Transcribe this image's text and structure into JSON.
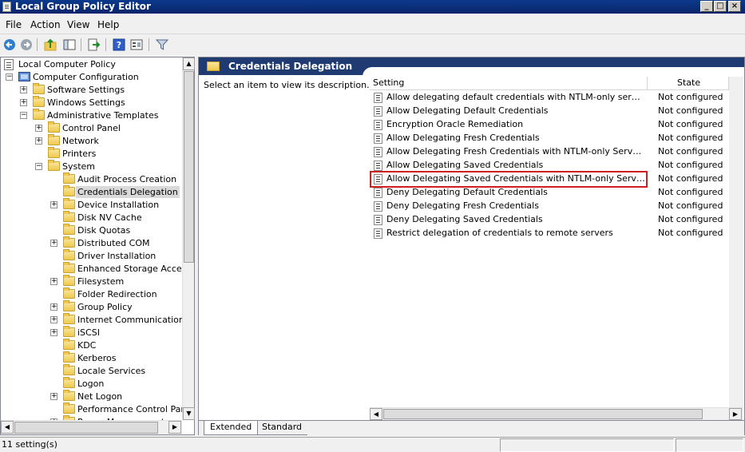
{
  "window": {
    "title": "Local Group Policy Editor"
  },
  "menu": [
    "File",
    "Action",
    "View",
    "Help"
  ],
  "toolbar": {
    "buttons": [
      "back-icon",
      "forward-icon",
      "up-folder-icon",
      "show-hide-tree-icon",
      "export-list-icon",
      "help-icon",
      "properties-icon",
      "filter-icon"
    ]
  },
  "tree": {
    "nodes": [
      {
        "label": "Local Computer Policy",
        "level": 0,
        "expander": "",
        "icon": "policy"
      },
      {
        "label": "Computer Configuration",
        "level": 1,
        "expander": "−",
        "icon": "computer"
      },
      {
        "label": "Software Settings",
        "level": 2,
        "expander": "+",
        "icon": "folder"
      },
      {
        "label": "Windows Settings",
        "level": 2,
        "expander": "+",
        "icon": "folder"
      },
      {
        "label": "Administrative Templates",
        "level": 2,
        "expander": "−",
        "icon": "folder"
      },
      {
        "label": "Control Panel",
        "level": 3,
        "expander": "+",
        "icon": "folder"
      },
      {
        "label": "Network",
        "level": 3,
        "expander": "+",
        "icon": "folder"
      },
      {
        "label": "Printers",
        "level": 3,
        "expander": "",
        "icon": "folder"
      },
      {
        "label": "System",
        "level": 3,
        "expander": "−",
        "icon": "folder"
      },
      {
        "label": "Audit Process Creation",
        "level": 4,
        "expander": "",
        "icon": "folder"
      },
      {
        "label": "Credentials Delegation",
        "level": 4,
        "expander": "",
        "icon": "folder",
        "selected": true
      },
      {
        "label": "Device Installation",
        "level": 4,
        "expander": "+",
        "icon": "folder"
      },
      {
        "label": "Disk NV Cache",
        "level": 4,
        "expander": "",
        "icon": "folder"
      },
      {
        "label": "Disk Quotas",
        "level": 4,
        "expander": "",
        "icon": "folder"
      },
      {
        "label": "Distributed COM",
        "level": 4,
        "expander": "+",
        "icon": "folder"
      },
      {
        "label": "Driver Installation",
        "level": 4,
        "expander": "",
        "icon": "folder"
      },
      {
        "label": "Enhanced Storage Access",
        "level": 4,
        "expander": "",
        "icon": "folder"
      },
      {
        "label": "Filesystem",
        "level": 4,
        "expander": "+",
        "icon": "folder"
      },
      {
        "label": "Folder Redirection",
        "level": 4,
        "expander": "",
        "icon": "folder"
      },
      {
        "label": "Group Policy",
        "level": 4,
        "expander": "+",
        "icon": "folder"
      },
      {
        "label": "Internet Communication Ma",
        "level": 4,
        "expander": "+",
        "icon": "folder"
      },
      {
        "label": "iSCSI",
        "level": 4,
        "expander": "+",
        "icon": "folder"
      },
      {
        "label": "KDC",
        "level": 4,
        "expander": "",
        "icon": "folder"
      },
      {
        "label": "Kerberos",
        "level": 4,
        "expander": "",
        "icon": "folder"
      },
      {
        "label": "Locale Services",
        "level": 4,
        "expander": "",
        "icon": "folder"
      },
      {
        "label": "Logon",
        "level": 4,
        "expander": "",
        "icon": "folder"
      },
      {
        "label": "Net Logon",
        "level": 4,
        "expander": "+",
        "icon": "folder"
      },
      {
        "label": "Performance Control Panel",
        "level": 4,
        "expander": "",
        "icon": "folder"
      },
      {
        "label": "Power Management",
        "level": 4,
        "expander": "+",
        "icon": "folder"
      }
    ]
  },
  "details": {
    "title": "Credentials Delegation",
    "description": "Select an item to view its description.",
    "columns": {
      "setting": "Setting",
      "state": "State"
    },
    "rows": [
      {
        "setting": "Allow delegating default credentials with NTLM-only server authe...",
        "state": "Not configured"
      },
      {
        "setting": "Allow Delegating Default Credentials",
        "state": "Not configured"
      },
      {
        "setting": "Encryption Oracle Remediation",
        "state": "Not configured"
      },
      {
        "setting": "Allow Delegating Fresh Credentials",
        "state": "Not configured"
      },
      {
        "setting": "Allow Delegating Fresh Credentials with NTLM-only Server Authe...",
        "state": "Not configured"
      },
      {
        "setting": "Allow Delegating Saved Credentials",
        "state": "Not configured"
      },
      {
        "setting": "Allow Delegating Saved Credentials with NTLM-only Server Authe...",
        "state": "Not configured",
        "highlighted": true
      },
      {
        "setting": "Deny Delegating Default Credentials",
        "state": "Not configured"
      },
      {
        "setting": "Deny Delegating Fresh Credentials",
        "state": "Not configured"
      },
      {
        "setting": "Deny Delegating Saved Credentials",
        "state": "Not configured"
      },
      {
        "setting": "Restrict delegation of credentials to remote servers",
        "state": "Not configured"
      }
    ],
    "tabs": [
      {
        "label": "Extended",
        "active": true
      },
      {
        "label": "Standard",
        "active": false
      }
    ]
  },
  "status": {
    "text": "11 setting(s)"
  },
  "colors": {
    "title_bar": "#0a246a",
    "header_band": "#1f3b72",
    "highlight": "#d01f1f"
  }
}
